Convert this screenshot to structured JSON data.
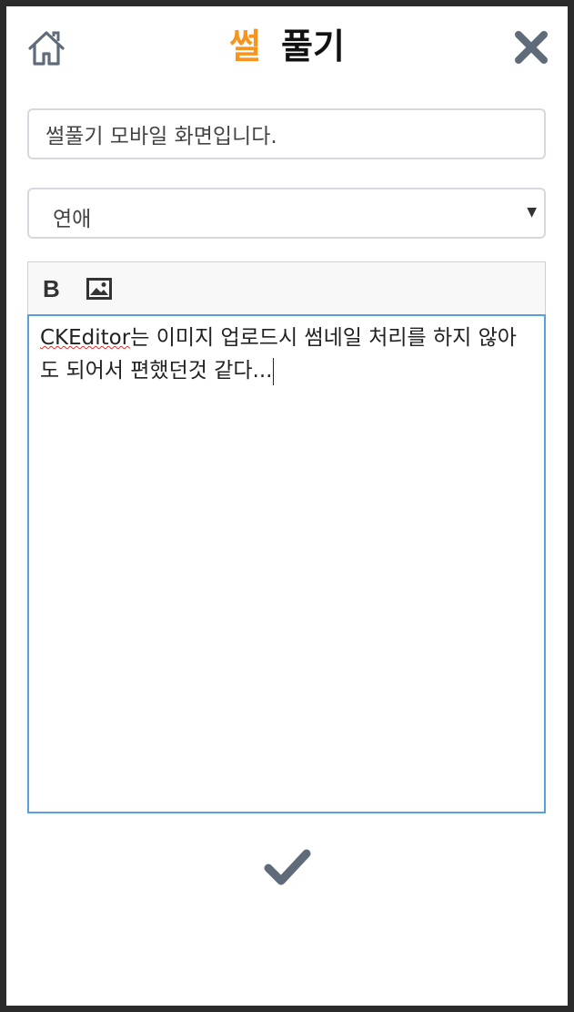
{
  "header": {
    "logo_accent": "썰",
    "logo_main": "풀기",
    "home_icon": "home-icon",
    "close_icon": "close-icon"
  },
  "form": {
    "title_value": "썰풀기 모바일 화면입니다.",
    "category_selected": "연애",
    "editor_text_spell": "CKEditor",
    "editor_text_rest": "는 이미지 업로드시 썸네일 처리를 하지 않아도 되어서 편했던것 같다...",
    "toolbar": {
      "bold_label": "B",
      "image_icon": "image-icon"
    },
    "submit_icon": "checkmark-icon"
  },
  "colors": {
    "accent": "#f7941d",
    "icon_gray": "#5f6b78",
    "editor_focus": "#5aa0e0"
  }
}
